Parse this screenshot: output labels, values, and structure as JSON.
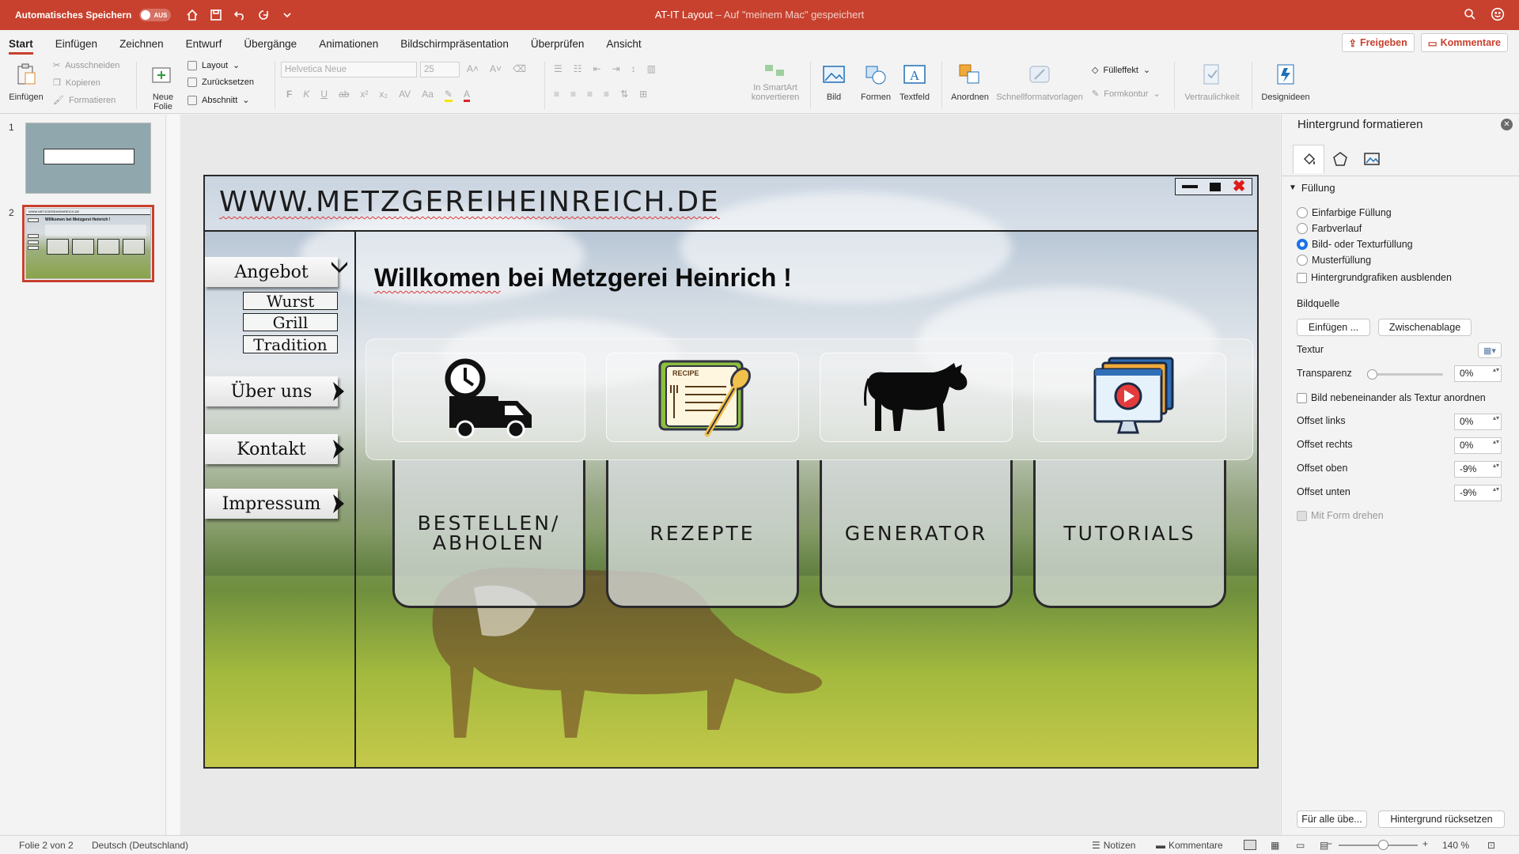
{
  "titlebar": {
    "autosave_label": "Automatisches Speichern",
    "autosave_state": "AUS",
    "doc_name": "AT-IT Layout",
    "doc_sub": " – Auf \"meinem Mac\" gespeichert"
  },
  "tabs": [
    "Start",
    "Einfügen",
    "Zeichnen",
    "Entwurf",
    "Übergänge",
    "Animationen",
    "Bildschirmpräsentation",
    "Überprüfen",
    "Ansicht"
  ],
  "share": {
    "freigeben": "Freigeben",
    "kommentare": "Kommentare"
  },
  "ribbon": {
    "einfuegen": "Einfügen",
    "ausschneiden": "Ausschneiden",
    "kopieren": "Kopieren",
    "formatieren": "Formatieren",
    "neue_folie_1": "Neue",
    "neue_folie_2": "Folie",
    "layout": "Layout",
    "zuruecksetzen": "Zurücksetzen",
    "abschnitt": "Abschnitt",
    "font_name": "Helvetica Neue",
    "font_size": "25",
    "smartart_1": "In SmartArt",
    "smartart_2": "konvertieren",
    "bild": "Bild",
    "formen": "Formen",
    "textfeld": "Textfeld",
    "anordnen": "Anordnen",
    "schnellformat": "Schnellformatvorlagen",
    "fuelleffekt": "Fülleffekt",
    "formkontur": "Formkontur",
    "vertraulichkeit": "Vertraulichkeit",
    "designideen": "Designideen"
  },
  "thumbnails": [
    {
      "num": "1"
    },
    {
      "num": "2",
      "url": "WWW.METZGEREIHEINREICH.DE",
      "title": "Willkomen bei Metzgerei Heinrich !"
    }
  ],
  "slide": {
    "url": "WWW.METZGEREIHEINREICH.DE",
    "welcome_first": "Willkomen",
    "welcome_rest": " bei Metzgerei Heinrich !",
    "nav": {
      "angebot": "Angebot",
      "wurst": "Wurst",
      "grill": "Grill",
      "tradition": "Tradition",
      "ueber_uns": "Über uns",
      "kontakt": "Kontakt",
      "impressum": "Impressum"
    },
    "icon_recipe_label": "RECIPE",
    "cards": [
      "BESTELLEN/\nABHOLEN",
      "REZEPTE",
      "GENERATOR",
      "TUTORIALS"
    ]
  },
  "pane": {
    "title": "Hintergrund formatieren",
    "section": "Füllung",
    "fill_options": [
      "Einfarbige Füllung",
      "Farbverlauf",
      "Bild- oder Texturfüllung",
      "Musterfüllung"
    ],
    "selected_fill": "Bild- oder Texturfüllung",
    "hide_graphics": "Hintergrundgrafiken ausblenden",
    "bildquelle": "Bildquelle",
    "btn_einfuegen": "Einfügen ...",
    "btn_zwischenablage": "Zwischenablage",
    "textur": "Textur",
    "transparenz": "Transparenz",
    "transparenz_value": "0%",
    "tile": "Bild nebeneinander als Textur anordnen",
    "offset_links": "Offset links",
    "offset_links_value": "0%",
    "offset_rechts": "Offset rechts",
    "offset_rechts_value": "0%",
    "offset_oben": "Offset oben",
    "offset_oben_value": "-9%",
    "offset_unten": "Offset unten",
    "offset_unten_value": "-9%",
    "rotate": "Mit Form drehen",
    "btn_all": "Für alle übe...",
    "btn_reset": "Hintergrund rücksetzen"
  },
  "status": {
    "slide_info": "Folie 2 von 2",
    "language": "Deutsch (Deutschland)",
    "notizen": "Notizen",
    "kommentare": "Kommentare",
    "zoom": "140 %"
  },
  "colors": {
    "accent": "#c8412e",
    "radio_on": "#1a73e8"
  }
}
